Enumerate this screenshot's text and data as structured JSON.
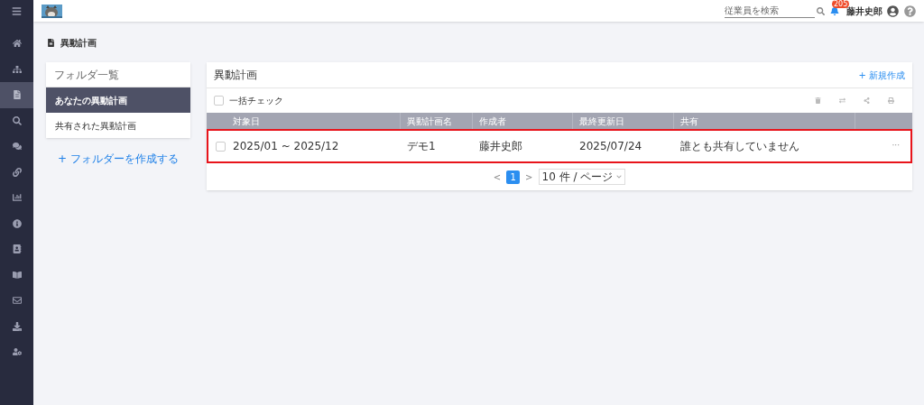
{
  "sidebar": {
    "items": [
      {
        "kind": "home",
        "selected": false
      },
      {
        "kind": "hierarchy",
        "selected": false
      },
      {
        "kind": "document",
        "selected": true
      },
      {
        "kind": "search",
        "selected": false
      },
      {
        "kind": "chat",
        "selected": false
      },
      {
        "kind": "link",
        "selected": false
      },
      {
        "kind": "chart",
        "selected": false
      },
      {
        "kind": "info",
        "selected": false
      },
      {
        "kind": "contact",
        "selected": false
      },
      {
        "kind": "book",
        "selected": false
      },
      {
        "kind": "mail",
        "selected": false
      },
      {
        "kind": "download",
        "selected": false
      },
      {
        "kind": "user",
        "selected": false
      }
    ]
  },
  "header": {
    "search": {
      "placeholder": "従業員を検索"
    },
    "notification_count": "205",
    "user_name": "藤井史郎"
  },
  "page_title": "異動計画",
  "folders": {
    "title": "フォルダ一覧",
    "items": [
      {
        "label": "あなたの異動計画",
        "selected": true
      },
      {
        "label": "共有された異動計画",
        "selected": false
      }
    ],
    "create": "+ フォルダーを作成する"
  },
  "plans": {
    "title": "異動計画",
    "new": "+ 新規作成",
    "check_all": {
      "label": "一括チェック",
      "checked": false
    },
    "columns": [
      "対象日",
      "異動計画名",
      "作成者",
      "最終更新日",
      "共有"
    ],
    "rows": [
      {
        "checked": false,
        "highlighted": true,
        "cells": [
          "2025/01 ~ 2025/12",
          "デモ1",
          "藤井史郎",
          "2025/07/24",
          "誰とも共有していません"
        ],
        "more": "···"
      }
    ],
    "pagination": {
      "prev": "<",
      "pages": [
        {
          "label": "1",
          "selected": true
        }
      ],
      "next": ">",
      "page_size": "10 件 / ページ"
    }
  }
}
